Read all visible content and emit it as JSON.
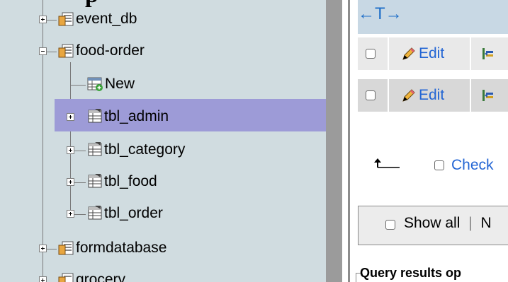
{
  "header_cut_text": "..p..",
  "nav": {
    "items": [
      {
        "label": "event_db",
        "kind": "database",
        "expander": "plus"
      },
      {
        "label": "food-order",
        "kind": "database",
        "expander": "minus"
      },
      {
        "label": "New",
        "kind": "new-table"
      },
      {
        "label": "tbl_admin",
        "kind": "table",
        "expander": "plus",
        "selected": true
      },
      {
        "label": "tbl_category",
        "kind": "table",
        "expander": "plus"
      },
      {
        "label": "tbl_food",
        "kind": "table",
        "expander": "plus"
      },
      {
        "label": "tbl_order",
        "kind": "table",
        "expander": "plus"
      },
      {
        "label": "formdatabase",
        "kind": "database",
        "expander": "plus"
      },
      {
        "label": "grocery",
        "kind": "database",
        "expander": "plus"
      }
    ]
  },
  "content": {
    "column_arrows": "←T→",
    "rows": [
      {
        "edit_label": "Edit"
      },
      {
        "edit_label": "Edit"
      }
    ],
    "check_all_label": "Check",
    "show_all_label": "Show all",
    "show_all_sep": "|",
    "show_all_next": "N",
    "query_results_title": "Query results op"
  },
  "colors": {
    "nav_bg": "#d0dce0",
    "selected_bg": "#9d9bd7",
    "link": "#2466d4",
    "arrow_blue": "#1e6ec8"
  }
}
